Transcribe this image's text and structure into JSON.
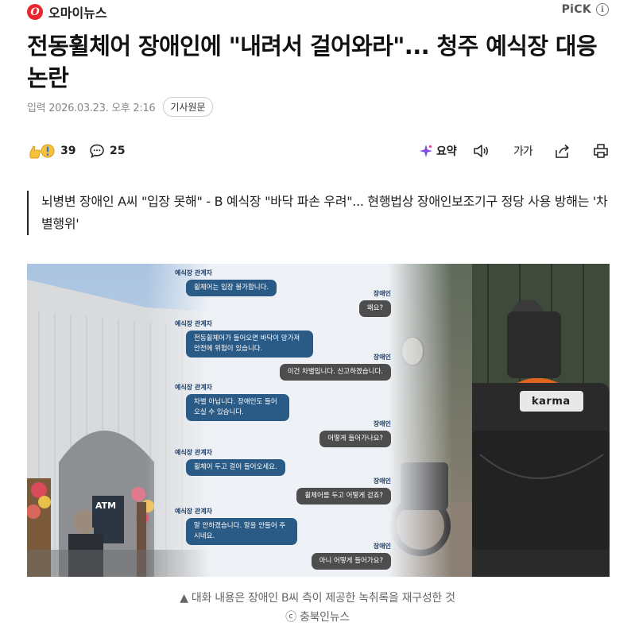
{
  "header": {
    "brand_logo": "O",
    "brand_name": "오마이뉴스",
    "pick_label": "PiCK",
    "info_icon": "i"
  },
  "article": {
    "headline": "전동휠체어 장애인에 \"내려서 걸어와라\"... 청주 예식장 대응 논란",
    "date": "입력 2026.03.23. 오후 2:16",
    "source_button": "기사원문",
    "lede": "뇌병변 장애인 A씨 \"입장 못해\" - B 예식장 \"바닥 파손 우려\"... 현행법상 장애인보조기구 정당 사용 방해는 '차별행위'"
  },
  "actions": {
    "reaction_count": "39",
    "comment_count": "25",
    "summary_label": "요약",
    "font_size_label": "가가"
  },
  "image": {
    "atm_label": "ATM",
    "wheelchair_brand": "karma",
    "chat": [
      {
        "speaker": "예식장 관계자",
        "text": "휠체어는 입장 불가합니다.",
        "side": "left"
      },
      {
        "speaker": "장애인",
        "text": "왜요?",
        "side": "right"
      },
      {
        "speaker": "예식장 관계자",
        "text": "전동휠체어가 들어오면 바닥이 망가져 안전에 위험이 있습니다.",
        "side": "left"
      },
      {
        "speaker": "장애인",
        "text": "이건 차별입니다. 신고하겠습니다.",
        "side": "right"
      },
      {
        "speaker": "예식장 관계자",
        "text": "차별 아닙니다. 장애인도 들어오실 수 있습니다.",
        "side": "left"
      },
      {
        "speaker": "장애인",
        "text": "어떻게 들어가나요?",
        "side": "right"
      },
      {
        "speaker": "예식장 관계자",
        "text": "휠체어 두고 걸어 들어오세요.",
        "side": "left"
      },
      {
        "speaker": "장애인",
        "text": "휠체어를 두고 어떻게 걷죠?",
        "side": "right"
      },
      {
        "speaker": "예식장 관계자",
        "text": "말 안하겠습니다. 말을 안들어 주시네요.",
        "side": "left"
      },
      {
        "speaker": "장애인",
        "text": "아니 어떻게 들어가요?",
        "side": "right"
      }
    ],
    "caption": "▲ 대화 내용은 장애인 B씨 측이 제공한 녹취록을 재구성한 것",
    "credit": "ⓒ 충북인뉴스"
  },
  "colors": {
    "brand_red": "#e8262b",
    "chat_in": "#2a5b86",
    "chat_out": "#4d4d4d"
  }
}
